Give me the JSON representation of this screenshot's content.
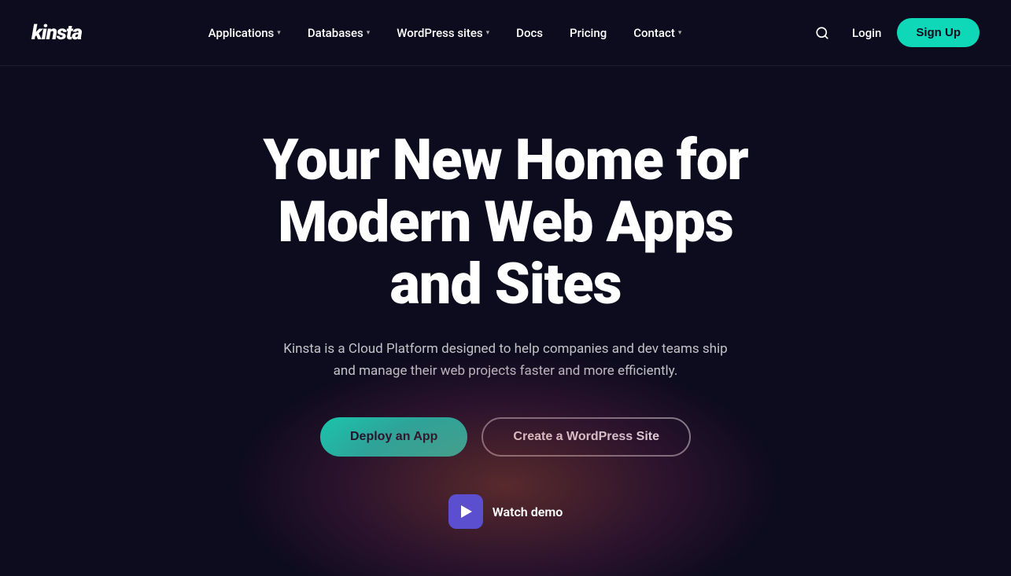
{
  "logo": {
    "text_kinsta": "Kinsta",
    "display": "kinsta"
  },
  "nav": {
    "items": [
      {
        "label": "Applications",
        "has_dropdown": true
      },
      {
        "label": "Databases",
        "has_dropdown": true
      },
      {
        "label": "WordPress sites",
        "has_dropdown": true
      },
      {
        "label": "Docs",
        "has_dropdown": false
      },
      {
        "label": "Pricing",
        "has_dropdown": false
      },
      {
        "label": "Contact",
        "has_dropdown": true
      }
    ],
    "login_label": "Login",
    "signup_label": "Sign Up"
  },
  "hero": {
    "title": "Your New Home for Modern Web Apps and Sites",
    "subtitle": "Kinsta is a Cloud Platform designed to help companies and dev teams ship and manage their web projects faster and more efficiently.",
    "btn_primary": "Deploy an App",
    "btn_secondary": "Create a WordPress Site",
    "watch_demo": "Watch demo"
  }
}
